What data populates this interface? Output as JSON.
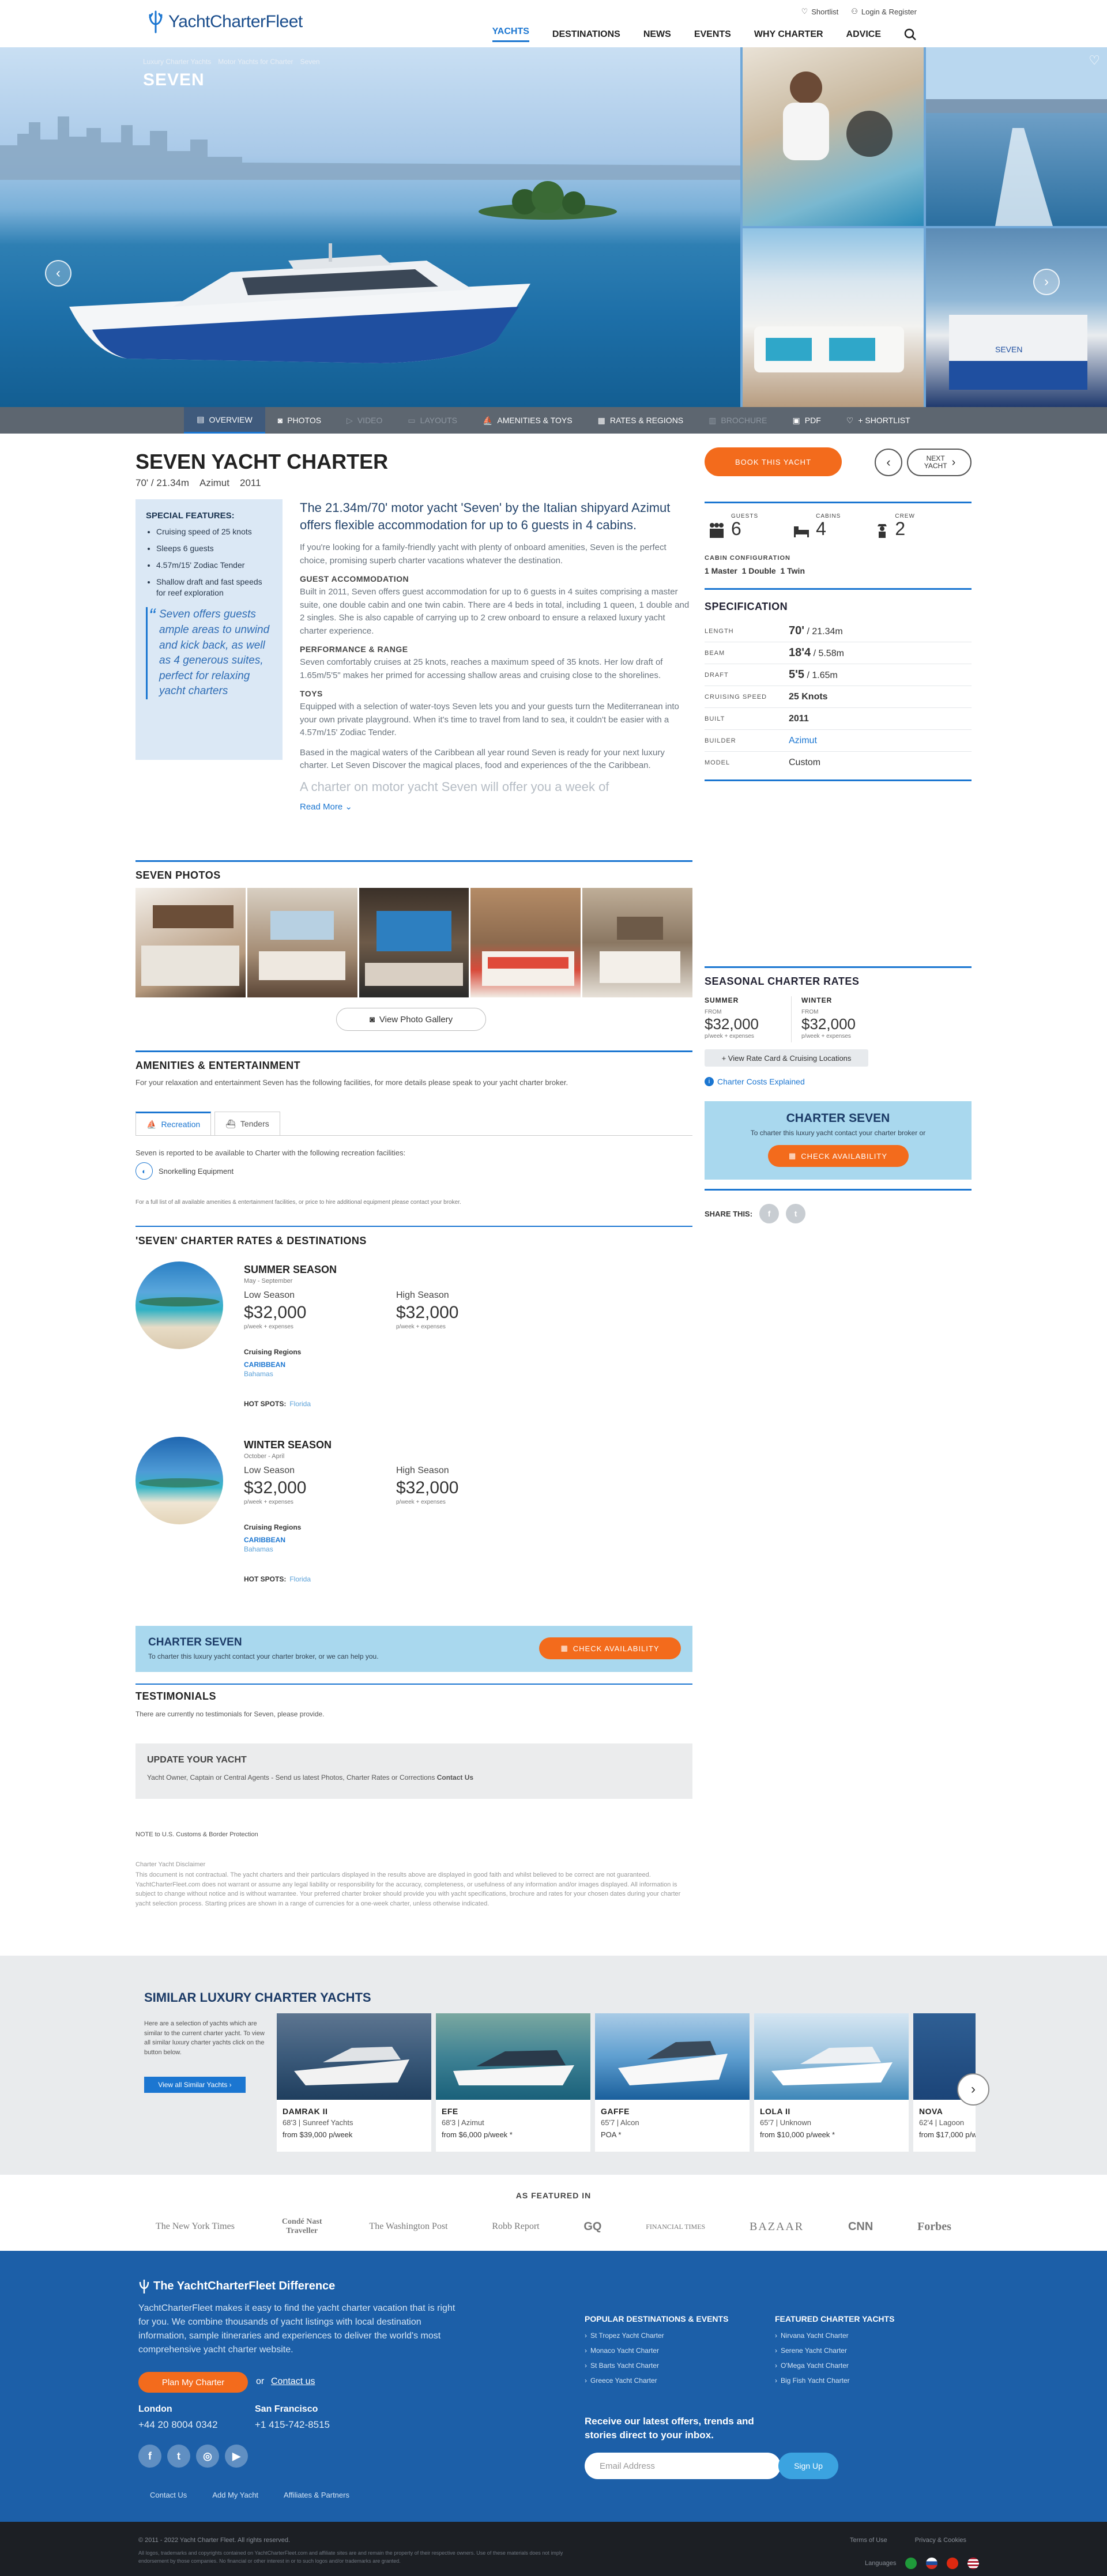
{
  "header": {
    "logo_text": "YachtCharterFleet",
    "shortlist": "Shortlist",
    "login": "Login & Register",
    "nav": [
      "YACHTS",
      "DESTINATIONS",
      "NEWS",
      "EVENTS",
      "WHY CHARTER",
      "ADVICE"
    ]
  },
  "hero": {
    "breadcrumb": [
      "Luxury Charter Yachts",
      "Motor Yachts for Charter",
      "Seven"
    ],
    "name": "SEVEN"
  },
  "tabs": [
    {
      "label": "OVERVIEW",
      "state": "active"
    },
    {
      "label": "PHOTOS",
      "state": "normal"
    },
    {
      "label": "VIDEO",
      "state": "disabled"
    },
    {
      "label": "LAYOUTS",
      "state": "disabled"
    },
    {
      "label": "AMENITIES & TOYS",
      "state": "normal"
    },
    {
      "label": "RATES & REGIONS",
      "state": "normal"
    },
    {
      "label": "BROCHURE",
      "state": "disabled"
    },
    {
      "label": "PDF",
      "state": "normal"
    },
    {
      "label": "+ SHORTLIST",
      "state": "normal"
    }
  ],
  "overview": {
    "title": "SEVEN YACHT CHARTER",
    "length": "70' / 21.34m",
    "builder": "Azimut",
    "year": "2011",
    "features_heading": "SPECIAL FEATURES:",
    "features": [
      "Cruising speed of 25 knots",
      "Sleeps 6 guests",
      "4.57m/15' Zodiac Tender",
      "Shallow draft and fast speeds for reef exploration"
    ],
    "quote": "Seven offers guests ample areas to unwind and kick back, as well as 4 generous suites, perfect for relaxing yacht charters",
    "lead": "The 21.34m/70' motor yacht 'Seven' by the Italian shipyard Azimut offers flexible accommodation for up to 6 guests in 4 cabins.",
    "intro": "If you're looking for a family-friendly yacht with plenty of onboard amenities, Seven is the perfect choice, promising superb charter vacations whatever the destination.",
    "h_accom": "GUEST ACCOMMODATION",
    "p_accom": "Built in 2011, Seven offers guest accommodation for up to 6 guests in 4 suites comprising a master suite, one double cabin and one twin cabin. There are 4 beds in total, including 1 queen, 1 double and 2 singles. She is also capable of carrying up to 2 crew onboard to ensure a relaxed luxury yacht charter experience.",
    "h_perf": "PERFORMANCE & RANGE",
    "p_perf": "Seven comfortably cruises at 25 knots, reaches a maximum speed of 35 knots. Her low draft of 1.65m/5'5\" makes her primed for accessing shallow areas and cruising close to the shorelines.",
    "h_toys": "TOYS",
    "p_toys": "Equipped with a selection of water-toys Seven lets you and your guests turn the Mediterranean into your own private playground. When it's time to travel from land to sea, it couldn't be easier with a 4.57m/15' Zodiac Tender.",
    "p_more": "Based in the magical waters of the Caribbean all year round Seven is ready for your next luxury charter. Let Seven Discover the magical places, food and experiences of the the Caribbean.",
    "fade": "A charter on motor yacht Seven will offer you a week of",
    "read_more": "Read More"
  },
  "sidebar": {
    "book": "BOOK THIS YACHT",
    "next": "NEXT YACHT",
    "guests_label": "GUESTS",
    "guests": "6",
    "cabins_label": "CABINS",
    "cabins": "4",
    "crew_label": "CREW",
    "crew": "2",
    "cabin_config_label": "CABIN CONFIGURATION",
    "cabin_config": "1 Master  1 Double  1 Twin",
    "spec_heading": "SPECIFICATION",
    "specs": [
      {
        "k": "LENGTH",
        "v": "70'",
        "s": " / 21.34m"
      },
      {
        "k": "BEAM",
        "v": "18'4",
        "s": " / 5.58m"
      },
      {
        "k": "DRAFT",
        "v": "5'5",
        "s": " / 1.65m"
      },
      {
        "k": "CRUISING SPEED",
        "v": "25 Knots",
        "s": ""
      },
      {
        "k": "BUILT",
        "v": "2011",
        "s": ""
      },
      {
        "k": "BUILDER",
        "v": "Azimut",
        "s": ""
      },
      {
        "k": "MODEL",
        "v": "Custom",
        "s": ""
      }
    ],
    "rates_heading": "SEASONAL CHARTER RATES",
    "summer_label": "SUMMER",
    "winter_label": "WINTER",
    "from": "FROM",
    "summer_price": "$32,000",
    "winter_price": "$32,000",
    "per": "p/week + expenses",
    "rate_card": "+  View Rate Card & Cruising Locations",
    "costs": "Charter Costs Explained",
    "charter_title": "CHARTER SEVEN",
    "charter_text": "To charter this luxury yacht contact your charter broker or",
    "check": "CHECK AVAILABILITY",
    "share": "SHARE THIS:"
  },
  "photos": {
    "heading": "SEVEN PHOTOS",
    "gallery_btn": "View Photo Gallery"
  },
  "amenities": {
    "heading": "AMENITIES & ENTERTAINMENT",
    "intro": "For your relaxation and entertainment Seven has the following facilities, for more details please speak to your yacht charter broker.",
    "tab_rec": "Recreation",
    "tab_ten": "Tenders",
    "reported": "Seven is reported to be available to Charter with the following recreation facilities:",
    "item": "Snorkelling Equipment",
    "footnote": "For a full list of all available amenities & entertainment facilities, or price to hire additional equipment please contact your broker."
  },
  "rates": {
    "heading": "'SEVEN' CHARTER RATES & DESTINATIONS",
    "seasons": [
      {
        "name": "SUMMER SEASON",
        "months": "May - September",
        "low_label": "Low Season",
        "high_label": "High Season",
        "low": "$32,000",
        "high": "$32,000",
        "per": "p/week + expenses",
        "cr_label": "Cruising Regions",
        "region": "CARIBBEAN",
        "sub": "Bahamas",
        "hot_label": "HOT SPOTS:",
        "hot": "Florida"
      },
      {
        "name": "WINTER SEASON",
        "months": "October - April",
        "low_label": "Low Season",
        "high_label": "High Season",
        "low": "$32,000",
        "high": "$32,000",
        "per": "p/week + expenses",
        "cr_label": "Cruising Regions",
        "region": "CARIBBEAN",
        "sub": "Bahamas",
        "hot_label": "HOT SPOTS:",
        "hot": "Florida"
      }
    ]
  },
  "cta": {
    "title": "CHARTER SEVEN",
    "text": "To charter this luxury yacht contact your charter broker, or we can help you.",
    "btn": "CHECK AVAILABILITY"
  },
  "testimonials": {
    "heading": "TESTIMONIALS",
    "text": "There are currently no testimonials for Seven, please provide."
  },
  "update": {
    "heading": "UPDATE YOUR YACHT",
    "text": "Yacht Owner, Captain or Central Agents - Send us latest Photos, Charter Rates or Corrections",
    "link": "Contact Us"
  },
  "note": "NOTE to U.S. Customs & Border Protection",
  "disclaimer_title": "Charter Yacht Disclaimer",
  "disclaimer": "This document is not contractual. The yacht charters and their particulars displayed in the results above are displayed in good faith and whilst believed to be correct are not guaranteed. YachtCharterFleet.com does not warrant or assume any legal liability or responsibility for the accuracy, completeness, or usefulness of any information and/or images displayed. All information is subject to change without notice and is without warrantee. Your preferred charter broker should provide you with yacht specifications, brochure and rates for your chosen dates during your charter yacht selection process. Starting prices are shown in a range of currencies for a one-week charter, unless otherwise indicated.",
  "similar": {
    "heading": "SIMILAR LUXURY CHARTER YACHTS",
    "intro": "Here are a selection of yachts which are similar to the current charter yacht. To view all similar luxury charter yachts click on the button below.",
    "view_all": "View all Similar Yachts  ›",
    "cards": [
      {
        "name": "DAMRAK II",
        "spec": "68'3 | Sunreef Yachts",
        "price": "from $39,000 p/week"
      },
      {
        "name": "EFE",
        "spec": "68'3 | Azimut",
        "price": "from $6,000 p/week *"
      },
      {
        "name": "GAFFE",
        "spec": "65'7 | Alcon",
        "price": "POA *"
      },
      {
        "name": "LOLA II",
        "spec": "65'7 | Unknown",
        "price": "from $10,000 p/week *"
      },
      {
        "name": "NOVA",
        "spec": "62'4 | Lagoon",
        "price": "from $17,000 p/week"
      }
    ]
  },
  "featured": {
    "heading": "AS FEATURED IN",
    "press": [
      "The New York Times",
      "Condé Nast Traveller",
      "The Washington Post",
      "Robb Report",
      "GQ",
      "FINANCIAL TIMES",
      "BAZAAR",
      "CNN",
      "Forbes"
    ]
  },
  "footer": {
    "heading": "The YachtCharterFleet Difference",
    "text": "YachtCharterFleet makes it easy to find the yacht charter vacation that is right for you. We combine thousands of yacht listings with local destination information, sample itineraries and experiences to deliver the world's most comprehensive yacht charter website.",
    "plan": "Plan My Charter",
    "or": "or",
    "contact": "Contact us",
    "london": "London",
    "london_tel": "+44 20 8004 0342",
    "sf": "San Francisco",
    "sf_tel": "+1 415-742-8515",
    "links": [
      "Contact Us",
      "Add My Yacht",
      "Affiliates & Partners"
    ],
    "pop_heading": "POPULAR DESTINATIONS & EVENTS",
    "pop": [
      "St Tropez Yacht Charter",
      "Monaco Yacht Charter",
      "St Barts Yacht Charter",
      "Greece Yacht Charter"
    ],
    "feat_heading": "FEATURED CHARTER YACHTS",
    "feat": [
      "Nirvana Yacht Charter",
      "Serene Yacht Charter",
      "O'Mega Yacht Charter",
      "Big Fish Yacht Charter"
    ],
    "newsletter": "Receive our latest offers, trends and stories direct to your inbox.",
    "email_placeholder": "Email Address",
    "signup": "Sign Up"
  },
  "bottom": {
    "copyright": "© 2011 - 2022 Yacht Charter Fleet. All rights reserved.",
    "small": "All logos, trademarks and copyrights contained on YachtCharterFleet.com and affiliate sites are and remain the property of their respective owners. Use of these materials does not imply endorsement by those companies. No financial or other interest in or to such logos and/or trademarks are granted.",
    "terms": "Terms of Use",
    "privacy": "Privacy & Cookies",
    "languages": "Languages"
  },
  "colors": {
    "brand_blue": "#1b76d1",
    "orange": "#f36b1c",
    "footer_blue": "#1c5fa8",
    "light_blue": "#a9d8ee"
  }
}
